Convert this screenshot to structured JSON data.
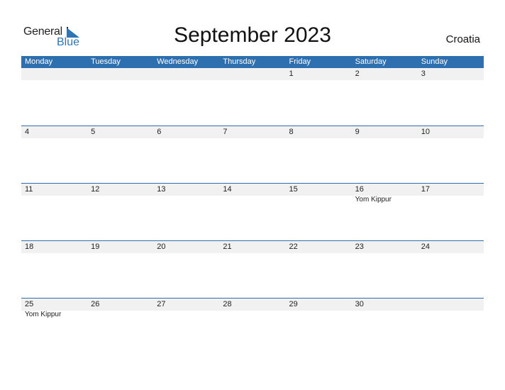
{
  "logo": {
    "general": "General",
    "blue": "Blue"
  },
  "title": "September 2023",
  "country": "Croatia",
  "weekdays": [
    "Monday",
    "Tuesday",
    "Wednesday",
    "Thursday",
    "Friday",
    "Saturday",
    "Sunday"
  ],
  "weeks": [
    {
      "days": [
        "",
        "",
        "",
        "",
        "1",
        "2",
        "3"
      ],
      "events": [
        "",
        "",
        "",
        "",
        "",
        "",
        ""
      ]
    },
    {
      "days": [
        "4",
        "5",
        "6",
        "7",
        "8",
        "9",
        "10"
      ],
      "events": [
        "",
        "",
        "",
        "",
        "",
        "",
        ""
      ]
    },
    {
      "days": [
        "11",
        "12",
        "13",
        "14",
        "15",
        "16",
        "17"
      ],
      "events": [
        "",
        "",
        "",
        "",
        "",
        "Yom Kippur",
        ""
      ]
    },
    {
      "days": [
        "18",
        "19",
        "20",
        "21",
        "22",
        "23",
        "24"
      ],
      "events": [
        "",
        "",
        "",
        "",
        "",
        "",
        ""
      ]
    },
    {
      "days": [
        "25",
        "26",
        "27",
        "28",
        "29",
        "30",
        ""
      ],
      "events": [
        "Yom Kippur",
        "",
        "",
        "",
        "",
        "",
        ""
      ]
    }
  ],
  "colors": {
    "accent": "#2e6fb0",
    "band": "#f1f1f1"
  }
}
